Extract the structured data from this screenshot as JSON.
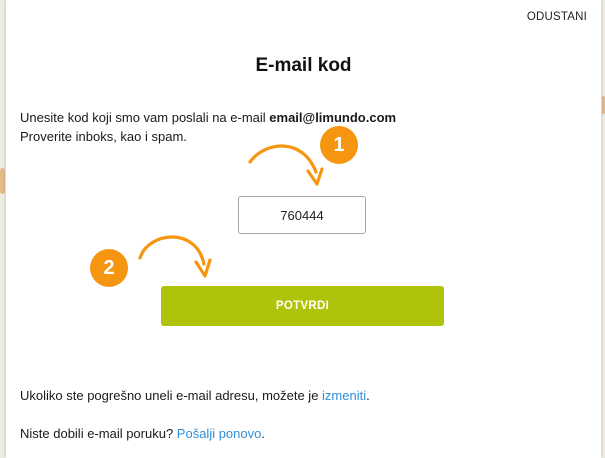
{
  "modal": {
    "cancel_label": "ODUSTANI",
    "title": "E-mail kod",
    "instruction_text": "Unesite kod koji smo vam poslali na e-mail ",
    "email": "email@limundo.com",
    "instruction_line2": "Proverite inboks, kao i spam.",
    "code_value": "760444",
    "confirm_label": "POTVRDI",
    "change_email_text": "Ukoliko ste pogrešno uneli e-mail adresu, možete je ",
    "change_email_link": "izmeniti",
    "change_email_suffix": ".",
    "resend_text": "Niste dobili e-mail poruku? ",
    "resend_link": "Pošalji ponovo",
    "resend_suffix": "."
  },
  "annotations": {
    "step1_number": "1",
    "step2_number": "2",
    "badge_color": "#f6950f",
    "arrow_icons": [
      "curved-arrow-icon",
      "curved-arrow-icon"
    ]
  },
  "colors": {
    "accent_button": "#aec30a",
    "link": "#2f8fd6"
  }
}
